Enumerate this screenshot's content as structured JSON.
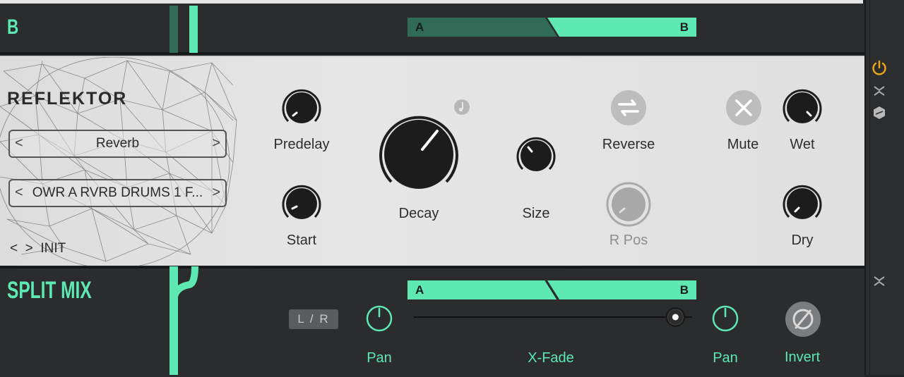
{
  "b_section": {
    "label": "B",
    "ab_left": "A",
    "ab_right": "B"
  },
  "plugin": {
    "title": "REFLEKTOR",
    "type_selector": {
      "value": "Reverb",
      "prev": "<",
      "next": ">"
    },
    "preset_selector": {
      "value": "OWR A RVRB DRUMS 1 F...",
      "prev": "<",
      "next": ">"
    },
    "preset_nav": {
      "prev": "<",
      "next": ">",
      "label": "INIT"
    },
    "knobs": {
      "predelay": "Predelay",
      "start": "Start",
      "decay": "Decay",
      "size": "Size",
      "wet": "Wet",
      "dry": "Dry"
    },
    "buttons": {
      "reverse": "Reverse",
      "rpos": "R Pos",
      "mute": "Mute"
    }
  },
  "split_mix": {
    "label": "SPLIT MIX",
    "lr_button": "L / R",
    "ab_left": "A",
    "ab_right": "B",
    "pan_left": "Pan",
    "xfade": "X-Fade",
    "pan_right": "Pan",
    "invert": "Invert",
    "xfade_position": 0.94
  },
  "colors": {
    "accent": "#5de8b4",
    "accent_dark": "#2f6b57",
    "power": "#e8a318"
  }
}
